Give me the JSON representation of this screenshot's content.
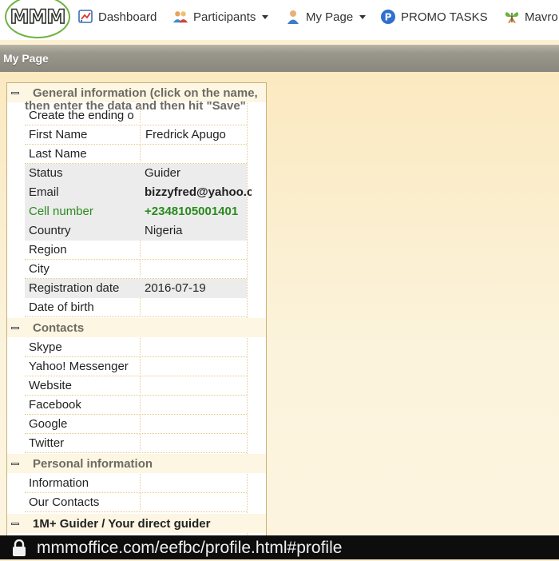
{
  "nav": {
    "logo": "MMM",
    "items": [
      {
        "label": "Dashboard",
        "icon": "dashboard-icon",
        "dropdown": false
      },
      {
        "label": "Participants",
        "icon": "participants-icon",
        "dropdown": true
      },
      {
        "label": "My Page",
        "icon": "user-icon",
        "dropdown": true
      },
      {
        "label": "PROMO TASKS",
        "icon": "promo-p-icon",
        "dropdown": false
      },
      {
        "label": "Mavro",
        "icon": "butterfly-icon",
        "dropdown": false
      }
    ]
  },
  "page_title": "My Page",
  "sections": {
    "general": {
      "title_line1": "General information (click on the name,",
      "title_line2": "then enter the data and then hit \"Save\"",
      "rows": [
        {
          "label": "Create the ending o",
          "value": ""
        },
        {
          "label": "First Name",
          "value": "Fredrick Apugo"
        },
        {
          "label": "Last Name",
          "value": ""
        },
        {
          "label": "Status",
          "value": "Guider"
        },
        {
          "label": "Email",
          "value": "bizzyfred@yahoo.c"
        },
        {
          "label": "Cell number",
          "value": "+2348105001401"
        },
        {
          "label": "Country",
          "value": "Nigeria"
        },
        {
          "label": "Region",
          "value": ""
        },
        {
          "label": "City",
          "value": ""
        },
        {
          "label": "Registration date",
          "value": "2016-07-19"
        },
        {
          "label": "Date of birth",
          "value": ""
        }
      ]
    },
    "contacts": {
      "title": "Contacts",
      "rows": [
        {
          "label": "Skype",
          "value": ""
        },
        {
          "label": "Yahoo! Messenger",
          "value": ""
        },
        {
          "label": "Website",
          "value": ""
        },
        {
          "label": "Facebook",
          "value": ""
        },
        {
          "label": "Google",
          "value": ""
        },
        {
          "label": "Twitter",
          "value": ""
        }
      ]
    },
    "personal": {
      "title": "Personal information",
      "rows": [
        {
          "label": "Information",
          "value": ""
        },
        {
          "label": "Our Contacts",
          "value": ""
        }
      ]
    },
    "guider": {
      "title": "1M+ Guider / Your direct guider"
    }
  },
  "statusbar": {
    "url": "mmmoffice.com/eefbc/profile.html#profile",
    "icon": "lock-icon"
  },
  "colors": {
    "accent_green": "#2a8a1e",
    "page_bg": "#fbf0cf",
    "title_bar": "#9a978c"
  }
}
